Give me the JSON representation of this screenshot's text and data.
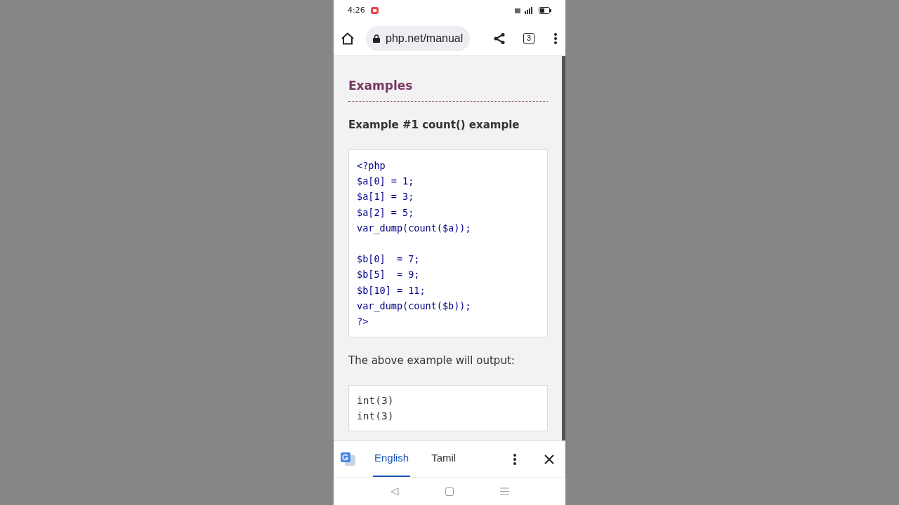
{
  "status_bar": {
    "time": "4:26"
  },
  "browser_bar": {
    "url": "php.net/manual",
    "tab_count": "3"
  },
  "content": {
    "heading": "Examples",
    "example_title": "Example #1 count() example",
    "code_groups": [
      [
        "<?php",
        "$a[0] = 1;",
        "$a[1] = 3;",
        "$a[2] = 5;",
        "var_dump(count($a));"
      ],
      [
        "$b[0]  = 7;",
        "$b[5]  = 9;",
        "$b[10] = 11;",
        "var_dump(count($b));",
        "?>"
      ]
    ],
    "output_intro": "The above example will output:",
    "output_lines": [
      "int(3)",
      "int(3)"
    ]
  },
  "translate_bar": {
    "languages": [
      {
        "label": "English",
        "selected": true
      },
      {
        "label": "Tamil",
        "selected": false
      }
    ]
  }
}
